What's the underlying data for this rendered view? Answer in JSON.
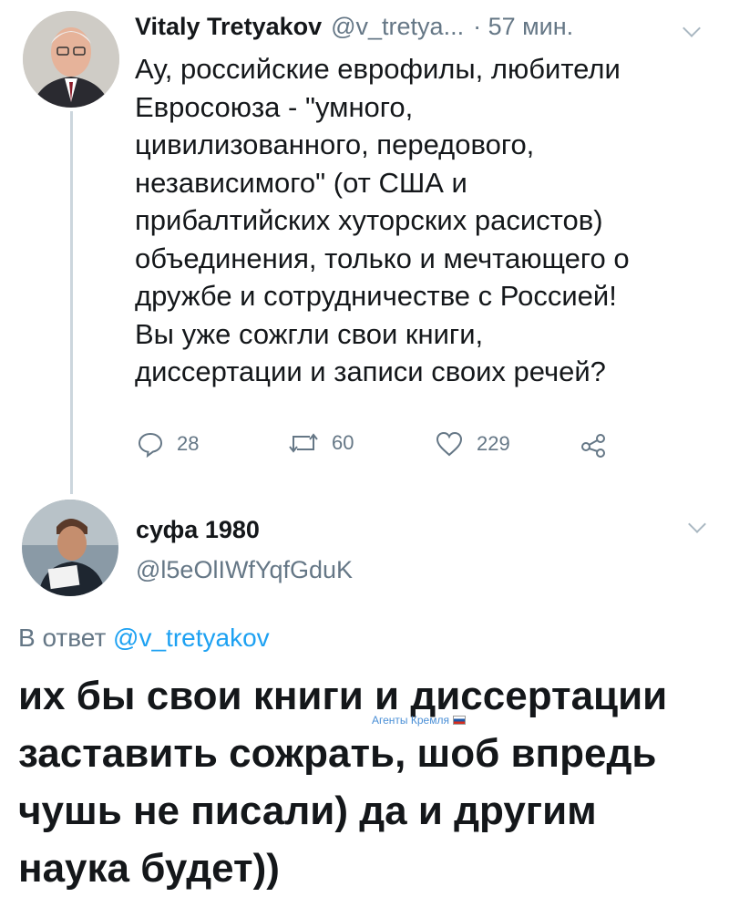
{
  "tweet": {
    "author_name": "Vitaly Tretyakov",
    "author_handle": "@v_tretya...",
    "time": "· 57 мин.",
    "text_lines": [
      "Ау, российские еврофилы, любители",
      "Евросоюза - \"умного,",
      "цивилизованного, передового,",
      "независимого\" (от США и",
      "прибалтийских хуторских расистов)",
      "объединения, только и мечтающего о",
      "дружбе и сотрудничестве с Россией!",
      "Вы уже сожгли свои книги,",
      "диссертации и записи своих речей?"
    ],
    "replies_count": "28",
    "retweets_count": "60",
    "likes_count": "229"
  },
  "reply": {
    "author_name": "суфа 1980",
    "author_handle": "@l5eOlIWfYqfGduK",
    "in_reply_prefix": "В ответ",
    "in_reply_handle": "@v_tretyakov",
    "text_lines": [
      "их бы свои книги и диссертации",
      "заставить сожрать,  шоб впредь",
      "чушь не писали) да и другим",
      "наука будет))"
    ]
  },
  "watermark": {
    "text": "Агенты Кремля"
  },
  "colors": {
    "text": "#14171a",
    "secondary": "#657786",
    "link": "#1da1f2",
    "divider": "#ccd6dd"
  }
}
